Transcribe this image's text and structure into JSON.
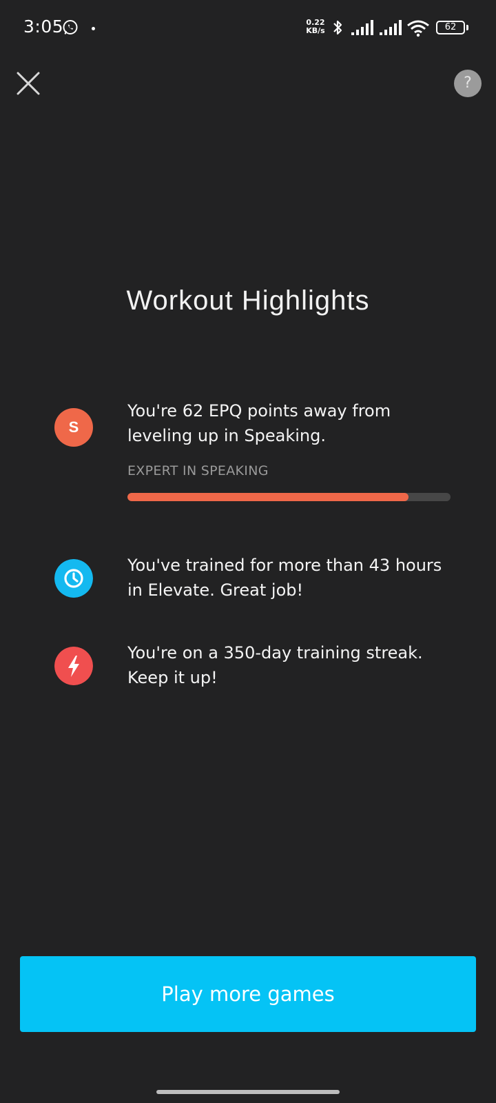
{
  "status_bar": {
    "time": "3:05",
    "net_speed_value": "0.22",
    "net_speed_unit": "KB/s",
    "battery": "62",
    "icons": [
      "whatsapp-icon",
      "bluetooth-icon",
      "signal-icon",
      "signal-icon",
      "wifi-icon",
      "battery-icon"
    ]
  },
  "header": {
    "close_icon": "close-icon",
    "help_label": "?"
  },
  "title": "Workout Highlights",
  "highlights": [
    {
      "icon": "speaking-badge",
      "badge_letter": "S",
      "color": "#ef6849",
      "text": "You're 62 EPQ points away from leveling up in Speaking.",
      "sublabel": "EXPERT IN SPEAKING",
      "progress": 0.87,
      "progress_color": "#ef6849",
      "track_color": "#474747"
    },
    {
      "icon": "clock-icon",
      "color": "#14b9f0",
      "text": "You've trained for more than 43 hours in Elevate. Great job!"
    },
    {
      "icon": "lightning-icon",
      "color": "#f04f4f",
      "text": "You're on a 350-day training streak. Keep it up!"
    }
  ],
  "cta": {
    "label": "Play more games",
    "color": "#05c3f5"
  },
  "colors": {
    "background": "#222223"
  }
}
